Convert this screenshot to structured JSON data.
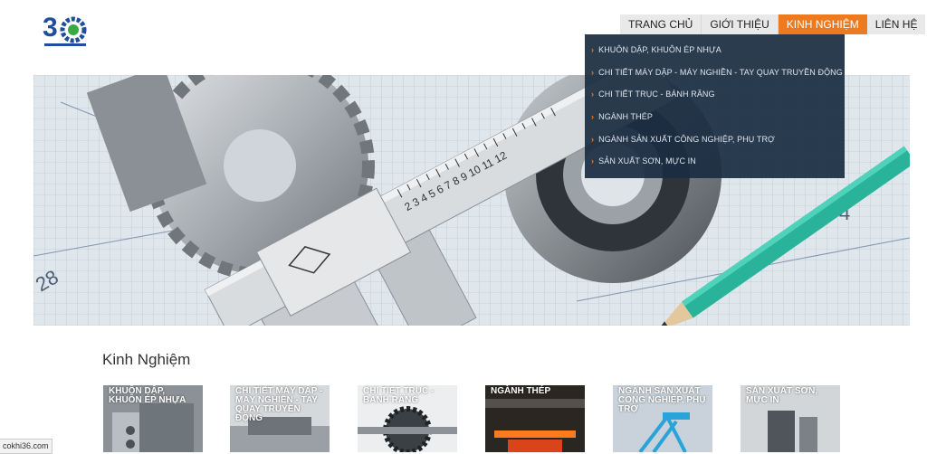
{
  "nav": {
    "items": [
      {
        "label": "TRANG CHỦ"
      },
      {
        "label": "GIỚI THIỆU"
      },
      {
        "label": "KINH NGHIỆM"
      },
      {
        "label": "LIÊN HỆ"
      }
    ],
    "active_index": 2
  },
  "dropdown": {
    "items": [
      {
        "label": "KHUÔN DẬP, KHUÔN ÉP NHỰA"
      },
      {
        "label": "CHI TIẾT MÁY DẬP - MÁY NGHIỀN - TAY QUAY TRUYỀN ĐỘNG"
      },
      {
        "label": "CHI TIẾT TRỤC - BÁNH RĂNG"
      },
      {
        "label": "NGÀNH THÉP"
      },
      {
        "label": "NGÀNH SẢN XUẤT CÔNG NGHIỆP, PHỤ TRỢ"
      },
      {
        "label": "SẢN XUẤT SƠN, MỰC IN"
      }
    ]
  },
  "slider": {
    "dots": 3,
    "active_dot": 2
  },
  "section": {
    "title": "Kinh Nghiệm"
  },
  "cards": [
    {
      "label": "KHUÔN DẬP, KHUÔN ÉP NHỰA"
    },
    {
      "label": "CHI TIẾT MÁY DẬP - MÁY NGHIỀN - TAY QUAY TRUYỀN ĐỘNG"
    },
    {
      "label": "CHI TIẾT TRỤC - BÁNH RĂNG"
    },
    {
      "label": "NGÀNH THÉP"
    },
    {
      "label": "NGÀNH SẢN XUẤT CÔNG NGHIỆP, PHỤ TRỢ"
    },
    {
      "label": "SẢN XUẤT SƠN, MỰC IN"
    }
  ],
  "status_bar": {
    "text": "cokhi36.com"
  },
  "colors": {
    "accent": "#ee7a1f",
    "logo_blue": "#1f4e9c",
    "logo_green": "#3aa845",
    "dropdown_bg": "#1b2d42"
  }
}
